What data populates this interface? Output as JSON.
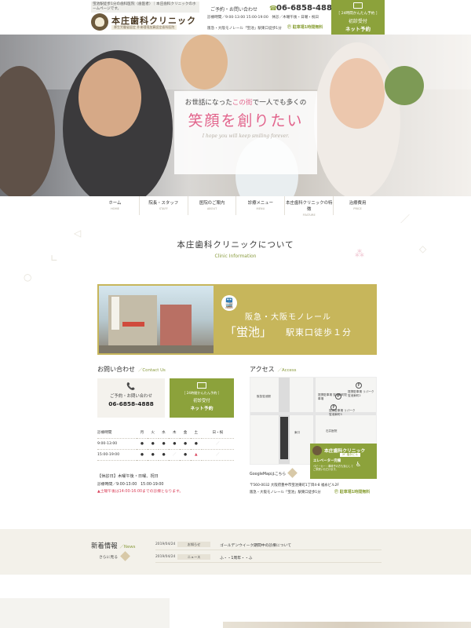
{
  "header": {
    "tagline": "蛍池駅徒歩1分の歯科医院（歯医者）｜本庄歯科クリニックのホームページです。",
    "clinic_name": "本庄歯科クリニック",
    "clinic_sub": "厚生労働省認定 外来環境加算認定歯科医院",
    "contact_label": "ご予約・お問い合わせ",
    "phone": "06-6858-4888",
    "hours": "診療時間／9:00-13:00 15:00-19:00　休診／木曜午後・日曜・祝日",
    "access": "阪急・大阪モノレール「蛍池」駅東口徒歩1分",
    "parking": "Ⓟ 駐車場1時間無料",
    "reserve_l1": "［ 24時間かんたん予約 ］",
    "reserve_l2": "初診受付",
    "reserve_l3": "ネット予約"
  },
  "hero": {
    "line1_pre": "お世話になった",
    "line1_accent": "この街",
    "line1_post": "で一人でも多くの",
    "line2": "笑顔を創りたい",
    "line3": "I hope you will keep smiling forever."
  },
  "nav": [
    {
      "ja": "ホーム",
      "en": "HOME"
    },
    {
      "ja": "院長・スタッフ",
      "en": "STAFF"
    },
    {
      "ja": "医院のご案内",
      "en": "ABOUT"
    },
    {
      "ja": "診療メニュー",
      "en": "MENU"
    },
    {
      "ja": "本庄歯科クリニックの特徴",
      "en": "FEATURE"
    },
    {
      "ja": "治療費用",
      "en": "PRICE"
    }
  ],
  "about": {
    "title": "本庄歯科クリニックについて",
    "subtitle": "Clinic Information",
    "station_line1": "阪急・大阪モノレール",
    "station_name": "「蛍池」",
    "station_line3": "駅東口徒歩１分"
  },
  "contact": {
    "title": "お問い合わせ",
    "title_en": "Contact Us",
    "tel_label": "ご予約・お問い合わせ",
    "tel_num": "06-6858-4888",
    "web_l1": "［ 24時間かんたん予約 ］",
    "web_l2": "初診受付",
    "web_l3": "ネット予約"
  },
  "schedule": {
    "head": [
      "診療時間",
      "月",
      "火",
      "水",
      "木",
      "金",
      "土",
      "日・祝"
    ],
    "rows": [
      {
        "time": "9:00-13:00",
        "cells": [
          "●",
          "●",
          "●",
          "●",
          "●",
          "●",
          "／"
        ]
      },
      {
        "time": "15:00-19:00",
        "cells": [
          "●",
          "●",
          "●",
          "／",
          "●",
          "▲",
          "／"
        ]
      }
    ],
    "closed": "【休診日】木曜午後・日曜、祝日",
    "closed_time": "診療時間／9:00-13:00　15:00-19:00",
    "note": "▲土曜午後は14:00-16:00までの診療となります。"
  },
  "access": {
    "title": "アクセス",
    "title_en": "Access",
    "gmap": "GoogleMapはこちら",
    "address": "〒560-0032 大阪府豊中市蛍池東町1丁目4-8 福永ビル2F",
    "address2": "阪急・大阪モノレール「蛍池」駅東口徒歩1分",
    "parking": "Ⓟ 駐車場1時間無料",
    "map_labels": {
      "station": "阪急蛍池駅",
      "parking1": "提携駐車場 蛍池東町駐車場",
      "parking2": "提携駐車場 リパーク蛍池東町2",
      "parking3": "提携駐車場 リパーク蛍池東町3",
      "exit": "東口",
      "hospital": "石井医院",
      "clinic": "本庄歯科クリニック",
      "floor": "2F 福永ビル",
      "elevator": "エレベーター完備",
      "elevator_sub": "ベビーカー・車椅子の方も安心してご来院いただけます。"
    }
  },
  "news": {
    "title": "新着情報",
    "title_en": "News",
    "more": "さらに見る",
    "items": [
      {
        "date": "2019/04/24",
        "cat": "お知らせ",
        "text": "ゴールデンウイーク期間中の診療について"
      },
      {
        "date": "2019/04/24",
        "cat": "ニュース",
        "text": "ふ・・1周年・・ふ"
      }
    ]
  },
  "colors": {
    "accent_green": "#8ca23b",
    "accent_pink": "#e2648c",
    "banner_gold": "#c7b65b"
  }
}
